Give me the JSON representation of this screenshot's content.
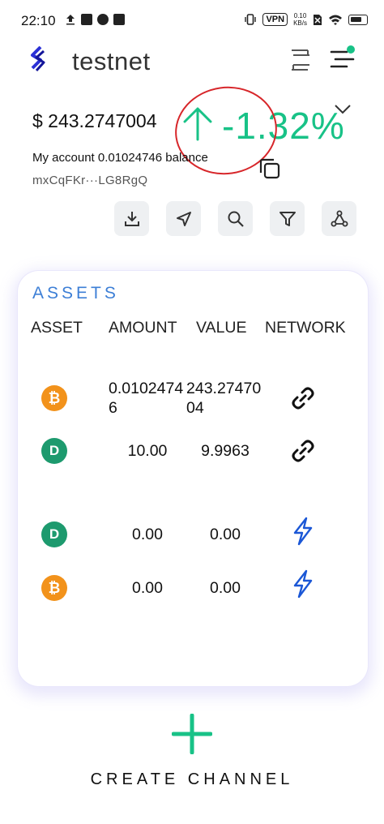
{
  "status_bar": {
    "time": "22:10",
    "vpn": "VPN",
    "speed_value": "0.10",
    "speed_unit": "KB/s",
    "icons": [
      "upload-icon",
      "mail-icon",
      "location-icon",
      "image-icon",
      "vibrate-icon",
      "vpn-icon",
      "no-sim-icon",
      "wifi-icon",
      "battery-icon"
    ]
  },
  "header": {
    "network_name": "testnet",
    "notification_dot_color": "#18c287"
  },
  "wallet": {
    "balance": "$ 243.2747004",
    "change": "-1.32%",
    "change_color": "#18c287",
    "account_line": "My account 0.01024746 balance",
    "address": "mxCqFKr···LG8RgQ"
  },
  "actions": [
    {
      "name": "receive-button",
      "icon": "download-icon"
    },
    {
      "name": "send-button",
      "icon": "send-icon"
    },
    {
      "name": "search-button",
      "icon": "search-icon"
    },
    {
      "name": "filter-button",
      "icon": "filter-icon"
    },
    {
      "name": "nodes-button",
      "icon": "network-nodes-icon"
    }
  ],
  "assets": {
    "title": "ASSETS",
    "title_color": "#3d7fd6",
    "headers": {
      "asset": "ASSET",
      "amount": "AMOUNT",
      "value": "VALUE",
      "network": "NETWORK"
    },
    "rows": [
      {
        "coin": "btc",
        "symbol": "₿",
        "amount": "0.01024746",
        "value": "243.2747004",
        "network_icon": "link-icon"
      },
      {
        "coin": "dash",
        "symbol": "D",
        "amount": "10.00",
        "value": "9.9963",
        "network_icon": "link-icon"
      },
      {
        "coin": "dash",
        "symbol": "D",
        "amount": "0.00",
        "value": "0.00",
        "network_icon": "lightning-icon"
      },
      {
        "coin": "btc",
        "symbol": "₿",
        "amount": "0.00",
        "value": "0.00",
        "network_icon": "lightning-icon"
      }
    ]
  },
  "create_channel": {
    "label": "CREATE CHANNEL",
    "color": "#18c287"
  }
}
